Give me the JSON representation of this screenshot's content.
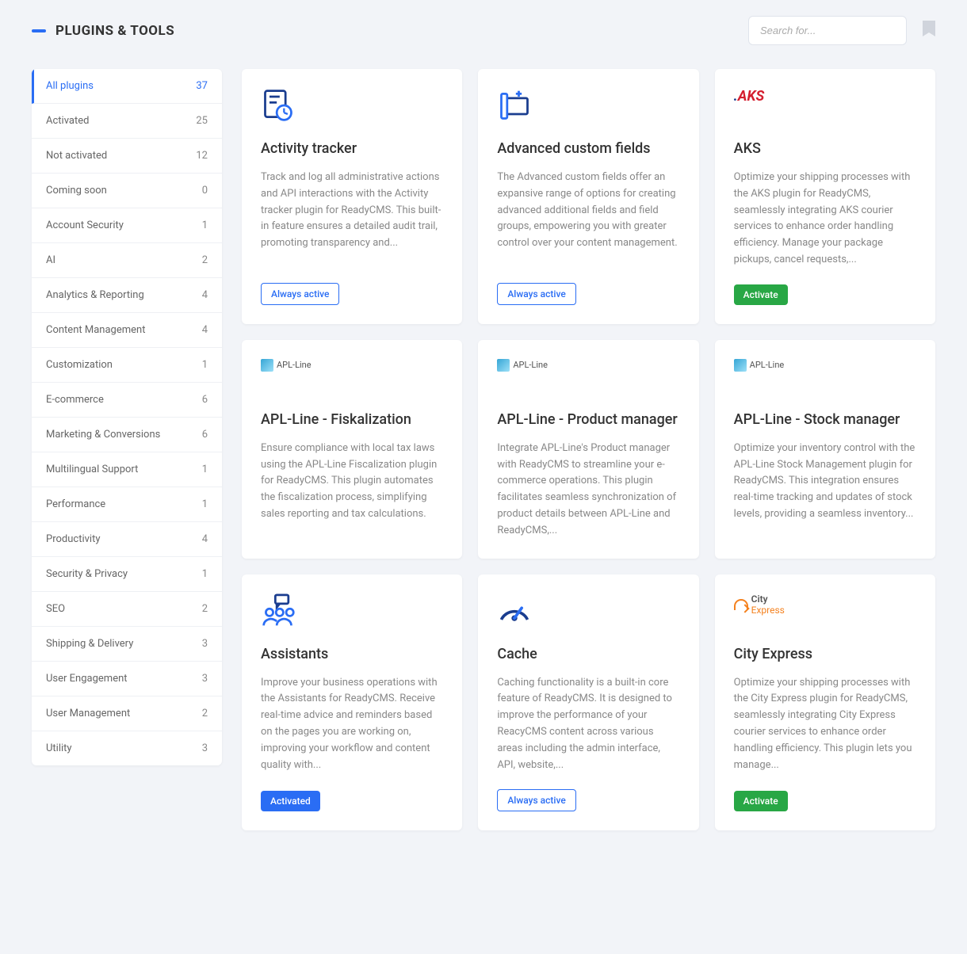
{
  "header": {
    "title": "PLUGINS & TOOLS",
    "search_placeholder": "Search for..."
  },
  "sidebar": {
    "items": [
      {
        "label": "All plugins",
        "count": "37",
        "active": true
      },
      {
        "label": "Activated",
        "count": "25"
      },
      {
        "label": "Not activated",
        "count": "12"
      },
      {
        "label": "Coming soon",
        "count": "0"
      },
      {
        "label": "Account Security",
        "count": "1"
      },
      {
        "label": "AI",
        "count": "2"
      },
      {
        "label": "Analytics & Reporting",
        "count": "4"
      },
      {
        "label": "Content Management",
        "count": "4"
      },
      {
        "label": "Customization",
        "count": "1"
      },
      {
        "label": "E-commerce",
        "count": "6"
      },
      {
        "label": "Marketing & Conversions",
        "count": "6"
      },
      {
        "label": "Multilingual Support",
        "count": "1"
      },
      {
        "label": "Performance",
        "count": "1"
      },
      {
        "label": "Productivity",
        "count": "4"
      },
      {
        "label": "Security & Privacy",
        "count": "1"
      },
      {
        "label": "SEO",
        "count": "2"
      },
      {
        "label": "Shipping & Delivery",
        "count": "3"
      },
      {
        "label": "User Engagement",
        "count": "3"
      },
      {
        "label": "User Management",
        "count": "2"
      },
      {
        "label": "Utility",
        "count": "3"
      }
    ]
  },
  "buttons": {
    "always_active": "Always active",
    "activate": "Activate",
    "activated": "Activated"
  },
  "cards": [
    {
      "icon": "activity",
      "title": "Activity tracker",
      "desc": "Track and log all administrative actions and API interactions with the Activity tracker plugin for ReadyCMS. This built-in feature ensures a detailed audit trail, promoting transparency and...",
      "action": "always_active"
    },
    {
      "icon": "fields",
      "title": "Advanced custom fields",
      "desc": "The Advanced custom fields offer an expansive range of options for creating advanced additional fields and field groups, empowering you with greater control over your content management.",
      "action": "always_active"
    },
    {
      "icon": "aks",
      "title": "AKS",
      "desc": "Optimize your shipping processes with the AKS plugin for ReadyCMS, seamlessly integrating AKS courier services to enhance order handling efficiency. Manage your package pickups, cancel requests,...",
      "action": "activate"
    },
    {
      "icon": "apl",
      "title": "APL-Line - Fiskalization",
      "desc": "Ensure compliance with local tax laws using the APL-Line Fiscalization plugin for ReadyCMS. This plugin automates the fiscalization process, simplifying sales reporting and tax calculations.",
      "action": "none"
    },
    {
      "icon": "apl",
      "title": "APL-Line - Product manager",
      "desc": "Integrate APL-Line's Product manager with ReadyCMS to streamline your e-commerce operations. This plugin facilitates seamless synchronization of product details between APL-Line and ReadyCMS,...",
      "action": "none"
    },
    {
      "icon": "apl",
      "title": "APL-Line - Stock manager",
      "desc": "Optimize your inventory control with the APL-Line Stock Management plugin for ReadyCMS. This integration ensures real-time tracking and updates of stock levels, providing a seamless inventory...",
      "action": "none"
    },
    {
      "icon": "assistants",
      "title": "Assistants",
      "desc": "Improve your business operations with the Assistants for ReadyCMS. Receive real-time advice and reminders based on the pages you are working on, improving your workflow and content quality with...",
      "action": "activated"
    },
    {
      "icon": "cache",
      "title": "Cache",
      "desc": "Caching functionality is a built-in core feature of ReadyCMS. It is designed to improve the performance of your ReacyCMS content across various areas including the admin interface, API, website,...",
      "action": "always_active"
    },
    {
      "icon": "city",
      "title": "City Express",
      "desc": "Optimize your shipping processes with the City Express plugin for ReadyCMS, seamlessly integrating City Express courier services to enhance order handling efficiency. This plugin lets you manage...",
      "action": "activate"
    }
  ]
}
